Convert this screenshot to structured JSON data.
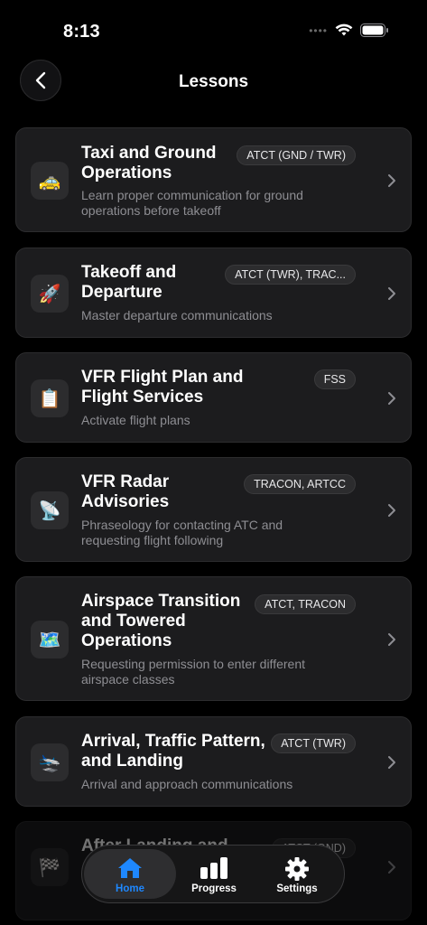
{
  "status_bar": {
    "time": "8:13"
  },
  "nav": {
    "title": "Lessons"
  },
  "lessons": [
    {
      "title": "Taxi and Ground Operations",
      "title_lines": [
        "Taxi and Ground",
        "Operations"
      ],
      "badge": "ATCT (GND / TWR)",
      "description_lines": [
        "Learn proper communication for ground",
        "operations before takeoff"
      ],
      "icon": "taxi-icon",
      "emoji": "🚕"
    },
    {
      "title": "Takeoff and Departure",
      "title_lines": [
        "Takeoff and",
        "Departure"
      ],
      "badge": "ATCT (TWR), TRAC...",
      "description_lines": [
        "Master departure communications"
      ],
      "icon": "rocket-icon",
      "emoji": "🚀"
    },
    {
      "title": "VFR Flight Plan and Flight Services",
      "title_lines": [
        "VFR Flight Plan and",
        "Flight Services"
      ],
      "badge": "FSS",
      "description_lines": [
        "Activate flight plans"
      ],
      "icon": "clipboard-icon",
      "emoji": "📋"
    },
    {
      "title": "VFR Radar Advisories",
      "title_lines": [
        "VFR Radar",
        "Advisories"
      ],
      "badge": "TRACON, ARTCC",
      "description_lines": [
        "Phraseology for contacting ATC and",
        "requesting flight following"
      ],
      "icon": "satellite-dish-icon",
      "emoji": "📡"
    },
    {
      "title": "Airspace Transition and Towered Operations",
      "title_lines": [
        "Airspace Transition",
        "and Towered",
        "Operations"
      ],
      "badge": "ATCT, TRACON",
      "description_lines": [
        "Requesting permission to enter different",
        "airspace classes"
      ],
      "icon": "map-icon",
      "emoji": "🗺️"
    },
    {
      "title": "Arrival, Traffic Pattern, and Landing",
      "title_lines": [
        "Arrival, Traffic Pattern,",
        "and Landing"
      ],
      "badge": "ATCT (TWR)",
      "description_lines": [
        "Arrival and approach communications"
      ],
      "icon": "plane-arriving-icon",
      "emoji": "🛬"
    },
    {
      "title": "After Landing and ...",
      "title_lines": [
        "After Landing and"
      ],
      "badge": "ATCT (GND)",
      "description_lines": [],
      "icon": "checkered-flag-icon",
      "emoji": "🏁"
    }
  ],
  "tab_bar": {
    "tabs": [
      {
        "label": "Home",
        "icon": "house-icon",
        "active": true
      },
      {
        "label": "Progress",
        "icon": "bar-chart-icon",
        "active": false
      },
      {
        "label": "Settings",
        "icon": "gear-icon",
        "active": false
      }
    ]
  },
  "colors": {
    "accent": "#1e88ff",
    "card": "#1c1c1e",
    "background": "#000000"
  }
}
